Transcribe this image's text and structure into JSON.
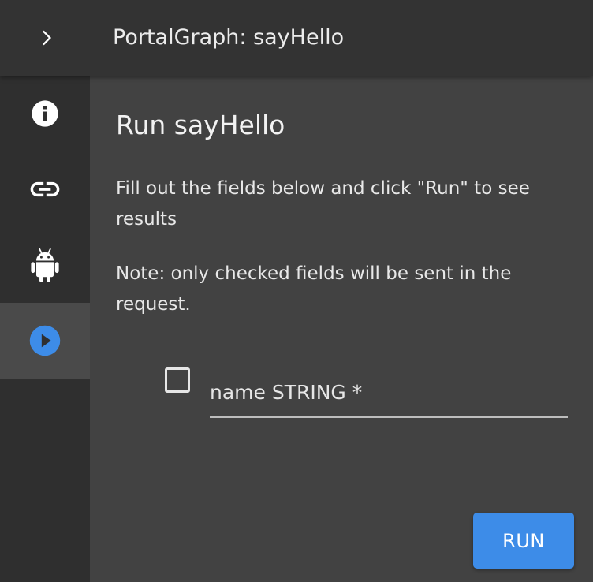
{
  "header": {
    "title": "PortalGraph: sayHello",
    "expand_icon": "chevron-right-icon"
  },
  "sidebar": {
    "items": [
      {
        "icon": "info-icon",
        "active": false
      },
      {
        "icon": "link-icon",
        "active": false
      },
      {
        "icon": "android-icon",
        "active": false
      },
      {
        "icon": "play-circle-icon",
        "active": true
      }
    ]
  },
  "main": {
    "title": "Run sayHello",
    "instructions": "Fill out the fields below and click \"Run\" to see results",
    "note": "Note: only checked fields will be sent in the request.",
    "field": {
      "label": "name STRING *",
      "checked": false
    },
    "run_label": "RUN"
  },
  "colors": {
    "accent": "#3d8ce8",
    "topbar": "#333333",
    "sidebar": "#2f2f2f",
    "main_background": "#424242"
  }
}
